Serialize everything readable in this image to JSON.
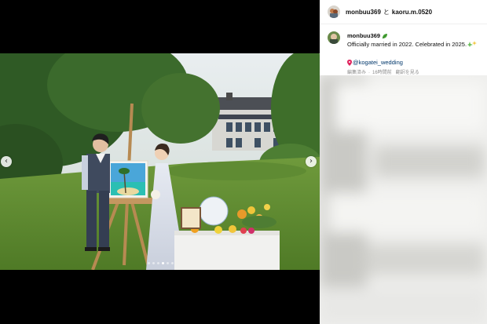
{
  "photo_post": {
    "nav": {
      "prev_icon": "chevron-left-icon",
      "next_icon": "chevron-right-icon"
    },
    "carousel": {
      "dot_count": 6,
      "active_index": 3
    }
  },
  "header": {
    "user1": "monbuu369",
    "conjunction": "と",
    "user2": "kaoru.m.0520"
  },
  "post": {
    "username": "monbuu369",
    "caption": "Officially married in 2022. Celebrated in 2025.",
    "location": "@kogatei_wedding",
    "meta": {
      "edited": "編集済み",
      "separator": "·",
      "time": "16時間前",
      "translate": "翻訳を見る"
    }
  },
  "colors": {
    "link": "#00376b",
    "meta": "#8e8e8e",
    "panel_bg": "#ffffff"
  }
}
